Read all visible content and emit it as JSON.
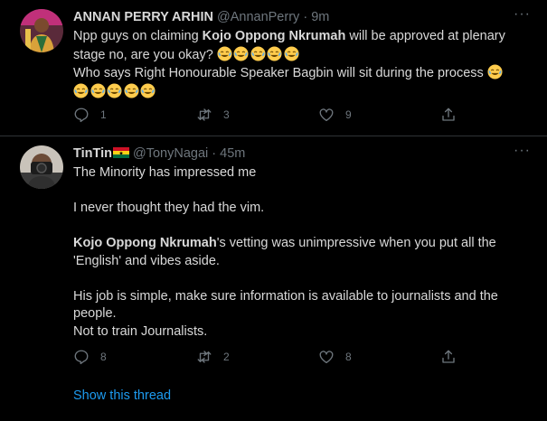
{
  "tweets": [
    {
      "display_name": "ANNAN PERRY ARHIN",
      "handle": "@AnnanPerry",
      "separator": "·",
      "time": "9m",
      "more_icon": "more-dots-icon",
      "line1_pre": "Npp guys on claiming ",
      "line1_bold": "Kojo Oppong Nkrumah",
      "line1_post": " will be approved at plenary stage no, are you okay?",
      "line2": "Who says Right Honourable Speaker Bagbin will sit during the process",
      "emoji_icon": "face-with-tears-of-joy-icon",
      "replies": "1",
      "retweets": "3",
      "likes": "9"
    },
    {
      "display_name": "TinTin",
      "flag_icon": "ghana-flag-icon",
      "handle": "@TonyNagai",
      "separator": "·",
      "time": "45m",
      "p1": "The Minority has impressed me",
      "p2": "I never thought they had the vim.",
      "p3_bold": "Kojo Oppong Nkrumah",
      "p3_post": "'s vetting was unimpressive when you put all the 'English' and vibes aside.",
      "p4_line1": "His job is simple, make sure information is available to journalists and the people.",
      "p4_line2": "Not to train Journalists.",
      "replies": "8",
      "retweets": "2",
      "likes": "8",
      "show_thread": "Show this thread"
    }
  ],
  "colors": {
    "background": "#000000",
    "text": "#d9d9d9",
    "muted": "#6e767d",
    "divider": "#2f3336",
    "link": "#1d9bf0"
  }
}
